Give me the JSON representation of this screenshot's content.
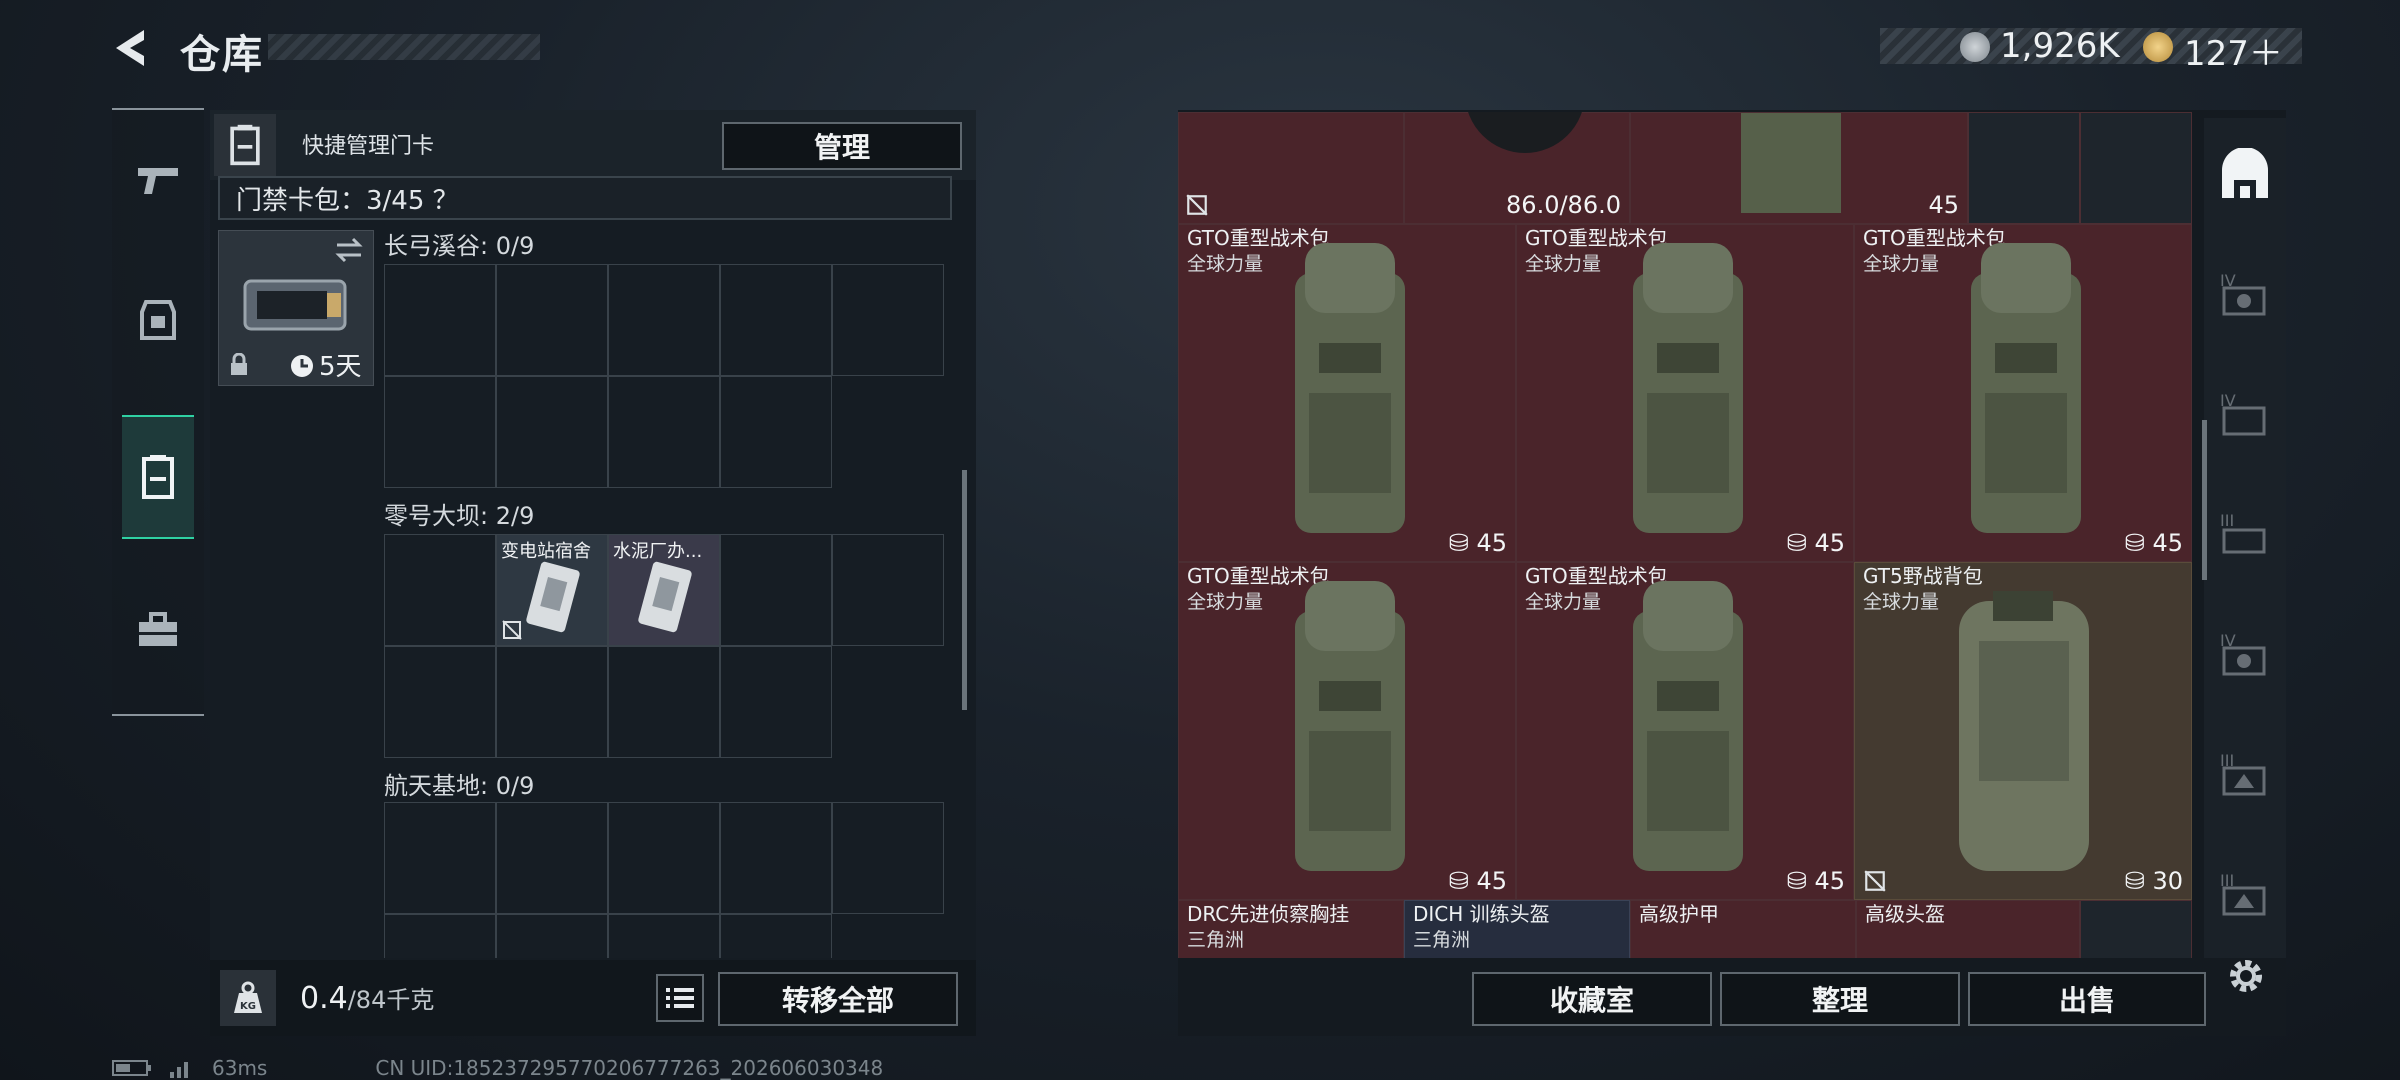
{
  "header": {
    "title": "仓库",
    "silver": "1,926K",
    "gold": "127＋"
  },
  "nav": [
    {
      "name": "weapon-tab",
      "icon": "pistol-icon"
    },
    {
      "name": "gear-tab",
      "icon": "armor-icon"
    },
    {
      "name": "keycard-tab",
      "icon": "keycard-icon"
    },
    {
      "name": "toolbox-tab",
      "icon": "toolbox-icon"
    }
  ],
  "left_panel": {
    "quick_label": "快捷管理门卡",
    "manage_label": "管理",
    "capacity": "门禁卡包：3/45 ？",
    "card_days": "5天",
    "zones": [
      {
        "label": "长弓溪谷: 0/9"
      },
      {
        "label": "零号大坝: 2/9",
        "items": [
          "变电站宿舍",
          "水泥厂办..."
        ]
      },
      {
        "label": "航天基地: 0/9"
      }
    ],
    "weight_value": "0.4",
    "weight_unit": "/84千克",
    "transfer_label": "转移全部"
  },
  "right_panel": {
    "top_count": "86.0/86.0",
    "top_capacity": "45",
    "items": [
      {
        "name": "GTO重型战术包",
        "sub": "全球力量",
        "count": "45"
      },
      {
        "name": "GTO重型战术包",
        "sub": "全球力量",
        "count": "45"
      },
      {
        "name": "GTO重型战术包",
        "sub": "全球力量",
        "count": "45"
      },
      {
        "name": "GTO重型战术包",
        "sub": "全球力量",
        "count": "45"
      },
      {
        "name": "GTO重型战术包",
        "sub": "全球力量",
        "count": "45"
      },
      {
        "name": "GT5野战背包",
        "sub": "全球力量",
        "count": "30"
      }
    ],
    "bottom_items": [
      {
        "name": "DRC先进侦察胸挂",
        "sub": "三角洲"
      },
      {
        "name": "DICH 训练头盔",
        "sub": "三角洲"
      },
      {
        "name": "高级护甲",
        "sub": ""
      },
      {
        "name": "高级头盔",
        "sub": ""
      }
    ],
    "buttons": {
      "collection": "收藏室",
      "sort": "整理",
      "sell": "出售"
    }
  },
  "status": {
    "ping": "63ms",
    "uid": "CN UID:185237295770206777263_202606030348"
  },
  "colors": {
    "accent": "#2fd1a3",
    "maroon": "#4a242a",
    "olive": "#443a30"
  }
}
